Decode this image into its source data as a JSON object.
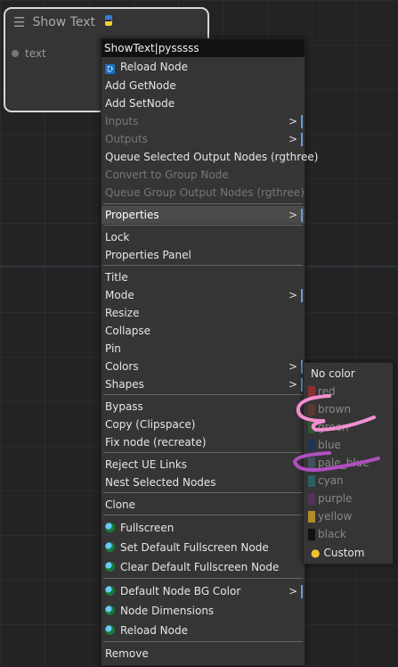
{
  "node": {
    "title": "Show Text",
    "menu_icon": "hamburger-icon",
    "badge_icon": "python-icon",
    "input_label": "text"
  },
  "context_menu": {
    "title": "ShowText|pysssss",
    "items": [
      {
        "label": "Reload Node",
        "icon": "reload-node-icon"
      },
      {
        "label": "Add GetNode"
      },
      {
        "label": "Add SetNode"
      },
      {
        "label": "Inputs",
        "disabled": true,
        "submenu": true
      },
      {
        "label": "Outputs",
        "disabled": true,
        "submenu": true
      },
      {
        "label": "Queue Selected Output Nodes (rgthree)"
      },
      {
        "label": "Convert to Group Node",
        "disabled": true
      },
      {
        "label": "Queue Group Output Nodes (rgthree)",
        "disabled": true
      },
      {
        "label": "Properties",
        "submenu": true,
        "highlighted": true
      },
      {
        "label": "Lock"
      },
      {
        "label": "Properties Panel"
      },
      {
        "label": "Title"
      },
      {
        "label": "Mode",
        "submenu": true
      },
      {
        "label": "Resize"
      },
      {
        "label": "Collapse"
      },
      {
        "label": "Pin"
      },
      {
        "label": "Colors",
        "submenu": true
      },
      {
        "label": "Shapes",
        "submenu": true
      },
      {
        "label": "Bypass"
      },
      {
        "label": "Copy (Clipspace)"
      },
      {
        "label": "Fix node (recreate)"
      },
      {
        "label": "Reject UE Links"
      },
      {
        "label": "Nest Selected Nodes"
      },
      {
        "label": "Clone"
      },
      {
        "label": "Fullscreen",
        "icon": "globe-icon"
      },
      {
        "label": "Set Default Fullscreen Node",
        "icon": "globe-icon"
      },
      {
        "label": "Clear Default Fullscreen Node",
        "icon": "globe-icon"
      },
      {
        "label": "Default Node BG Color",
        "icon": "globe-icon",
        "submenu": true
      },
      {
        "label": "Node Dimensions",
        "icon": "globe-icon"
      },
      {
        "label": "Reload Node",
        "icon": "globe-icon"
      },
      {
        "label": "Remove"
      }
    ],
    "submenu_arrow": ">"
  },
  "colors_menu": {
    "items": [
      {
        "label": "No color"
      },
      {
        "label": "red",
        "swatch": "#8a3232"
      },
      {
        "label": "brown",
        "swatch": "#593930"
      },
      {
        "label": "green",
        "swatch": "#335533"
      },
      {
        "label": "blue",
        "swatch": "#223355"
      },
      {
        "label": "pale_blue",
        "swatch": "#3f5159"
      },
      {
        "label": "cyan",
        "swatch": "#2a6166"
      },
      {
        "label": "purple",
        "swatch": "#553355"
      },
      {
        "label": "yellow",
        "swatch": "#b58b2a"
      },
      {
        "label": "black",
        "swatch": "#111111"
      },
      {
        "label": "Custom",
        "icon": "palette-icon"
      }
    ]
  },
  "annotation_colors": {
    "pink": "#f28fd0",
    "purple": "#b14fc0"
  }
}
